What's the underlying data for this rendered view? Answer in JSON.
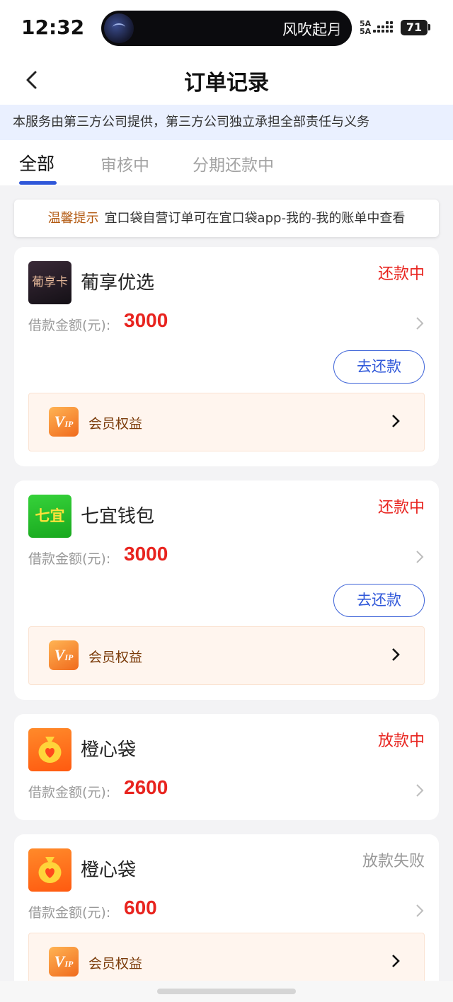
{
  "status_bar": {
    "time": "12:32",
    "now_playing": "风吹起月",
    "network_top": "5A",
    "network_bottom": "5A",
    "battery": "71"
  },
  "header": {
    "title": "订单记录",
    "back_icon": "chevron-left-icon"
  },
  "notice": "本服务由第三方公司提供，第三方公司独立承担全部责任与义务",
  "tabs": [
    {
      "label": "全部",
      "active": true
    },
    {
      "label": "审核中",
      "active": false
    },
    {
      "label": "分期还款中",
      "active": false
    }
  ],
  "tip": {
    "label": "温馨提示",
    "text": "宜口袋自营订单可在宜口袋app-我的-我的账单中查看"
  },
  "orders": [
    {
      "logo_text": "葡享卡",
      "name": "葡享优选",
      "status": "还款中",
      "status_color": "#e8241f",
      "amount_label": "借款金额(元):",
      "amount": "3000",
      "repay_button": "去还款",
      "vip": "会员权益"
    },
    {
      "logo_text": "七宜",
      "name": "七宜钱包",
      "status": "还款中",
      "status_color": "#e8241f",
      "amount_label": "借款金额(元):",
      "amount": "3000",
      "repay_button": "去还款",
      "vip": "会员权益"
    },
    {
      "logo_icon": "money-bag-heart-icon",
      "name": "橙心袋",
      "status": "放款中",
      "status_color": "#e8241f",
      "amount_label": "借款金额(元):",
      "amount": "2600"
    },
    {
      "logo_icon": "money-bag-heart-icon",
      "name": "橙心袋",
      "status": "放款失败",
      "status_color": "#999999",
      "amount_label": "借款金额(元):",
      "amount": "600",
      "vip": "会员权益"
    }
  ],
  "vip_badge": {
    "main": "V",
    "sub": "IP"
  },
  "colors": {
    "accent": "#2f57d9",
    "alert_red": "#e8241f",
    "notice_bg": "#eaf0ff"
  }
}
